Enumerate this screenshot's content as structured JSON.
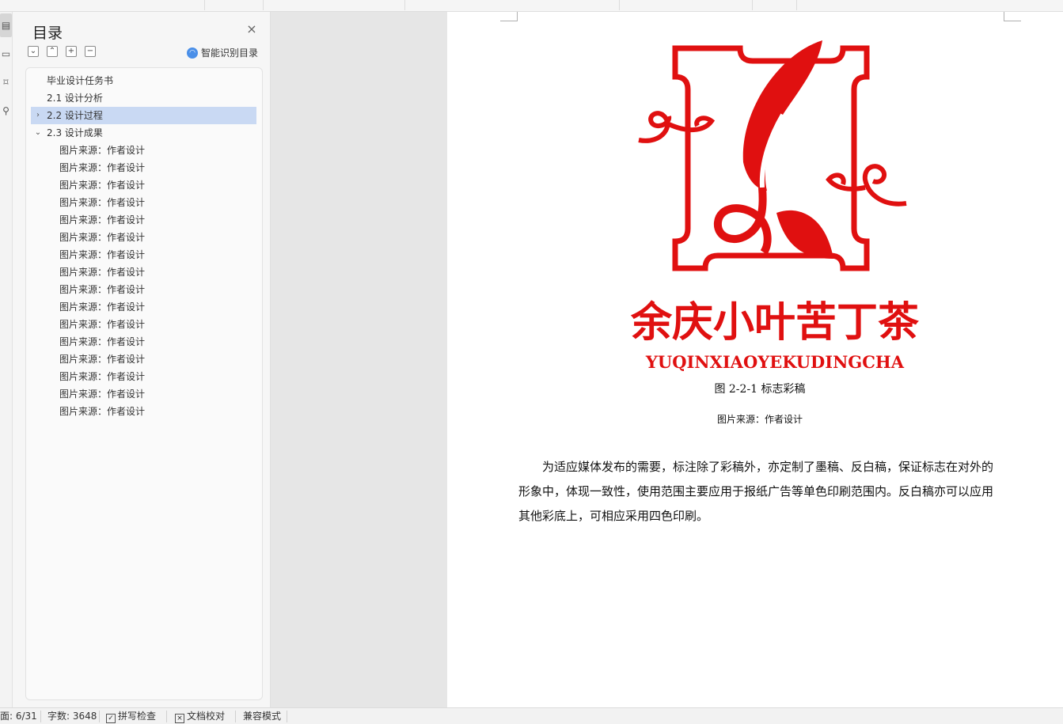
{
  "toc": {
    "title": "目录",
    "close_glyph": "×",
    "tools": [
      "collapse-all-icon",
      "expand-up-icon",
      "add-level-icon",
      "remove-level-icon"
    ],
    "smart_label": "智能识别目录",
    "items": [
      {
        "label": "毕业设计任务书",
        "level": 0,
        "arrow": ""
      },
      {
        "label": "2.1 设计分析",
        "level": 0,
        "arrow": ""
      },
      {
        "label": "2.2 设计过程",
        "level": 0,
        "arrow": "›",
        "selected": true
      },
      {
        "label": "2.3 设计成果",
        "level": 0,
        "arrow": "⌄"
      },
      {
        "label": "图片来源：作者设计",
        "level": 1
      },
      {
        "label": "图片来源：作者设计",
        "level": 1
      },
      {
        "label": "图片来源：作者设计",
        "level": 1
      },
      {
        "label": "图片来源：作者设计",
        "level": 1
      },
      {
        "label": "图片来源：作者设计",
        "level": 1
      },
      {
        "label": "图片来源：作者设计",
        "level": 1
      },
      {
        "label": "图片来源：作者设计",
        "level": 1
      },
      {
        "label": "图片来源：作者设计",
        "level": 1
      },
      {
        "label": "图片来源：作者设计",
        "level": 1
      },
      {
        "label": "图片来源：作者设计",
        "level": 1
      },
      {
        "label": "图片来源：作者设计",
        "level": 1
      },
      {
        "label": "图片来源：作者设计",
        "level": 1
      },
      {
        "label": "图片来源：作者设计",
        "level": 1
      },
      {
        "label": "图片来源：作者设计",
        "level": 1
      },
      {
        "label": "图片来源：作者设计",
        "level": 1
      },
      {
        "label": "图片来源：作者设计",
        "level": 1
      }
    ]
  },
  "document": {
    "logo": {
      "brand_text": "余庆小叶苦丁茶",
      "brand_pinyin": "YUQINXIAOYEKUDINGCHA",
      "color": "#e01010"
    },
    "caption": "图 2-2-1 标志彩稿",
    "source": "图片来源：作者设计",
    "paragraph": "为适应媒体发布的需要，标注除了彩稿外，亦定制了墨稿、反白稿，保证标志在对外的形象中，体现一致性，使用范围主要应用于报纸广告等单色印刷范围内。反白稿亦可以应用其他彩底上，可相应采用四色印刷。"
  },
  "status_bar": {
    "page": "面: 6/31",
    "word_count": "字数: 3648",
    "spell_check": "拼写检查",
    "doc_proof": "文档校对",
    "compat_mode": "兼容模式"
  }
}
